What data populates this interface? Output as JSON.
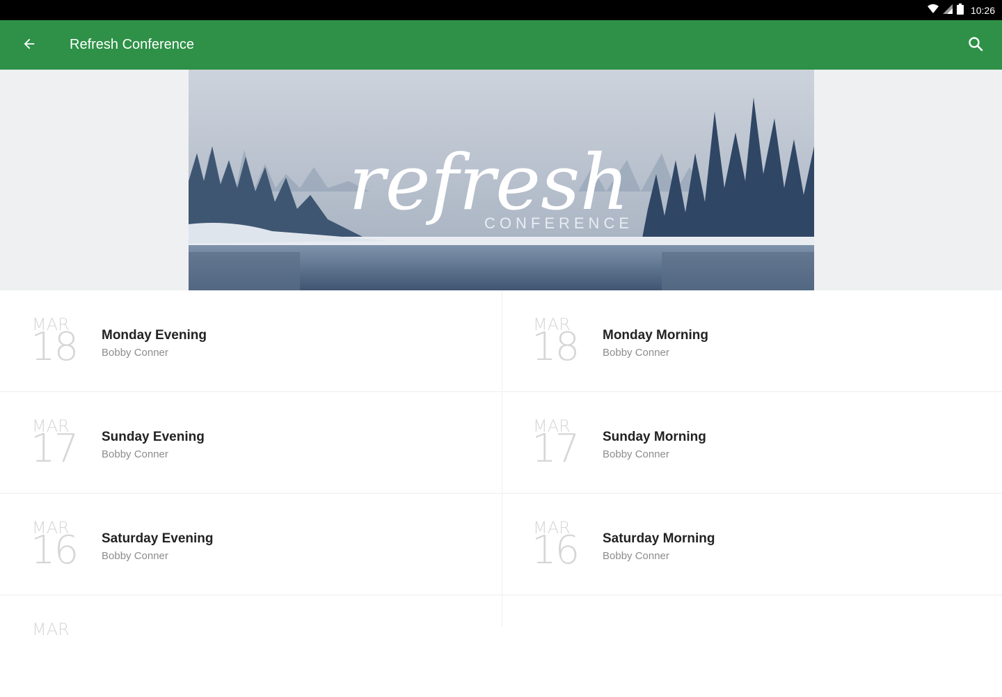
{
  "status": {
    "time": "10:26"
  },
  "header": {
    "title": "Refresh Conference"
  },
  "banner": {
    "script_text": "refresh",
    "sub_text": "CONFERENCE"
  },
  "sessions": [
    {
      "mon": "MAR",
      "day": "18",
      "title": "Monday Evening",
      "speaker": "Bobby Conner"
    },
    {
      "mon": "MAR",
      "day": "18",
      "title": "Monday Morning",
      "speaker": "Bobby Conner"
    },
    {
      "mon": "MAR",
      "day": "17",
      "title": "Sunday Evening",
      "speaker": "Bobby Conner"
    },
    {
      "mon": "MAR",
      "day": "17",
      "title": "Sunday Morning",
      "speaker": "Bobby Conner"
    },
    {
      "mon": "MAR",
      "day": "16",
      "title": "Saturday Evening",
      "speaker": "Bobby Conner"
    },
    {
      "mon": "MAR",
      "day": "16",
      "title": "Saturday Morning",
      "speaker": "Bobby Conner"
    },
    {
      "mon": "MAR"
    }
  ],
  "colors": {
    "app_bar": "#2e9147",
    "status_bar": "#000000",
    "date_text": "#d6d6d6"
  },
  "icons": {
    "back": "arrow-left-icon",
    "search": "search-icon",
    "wifi": "wifi-icon",
    "signal": "signal-icon",
    "battery": "battery-icon"
  }
}
